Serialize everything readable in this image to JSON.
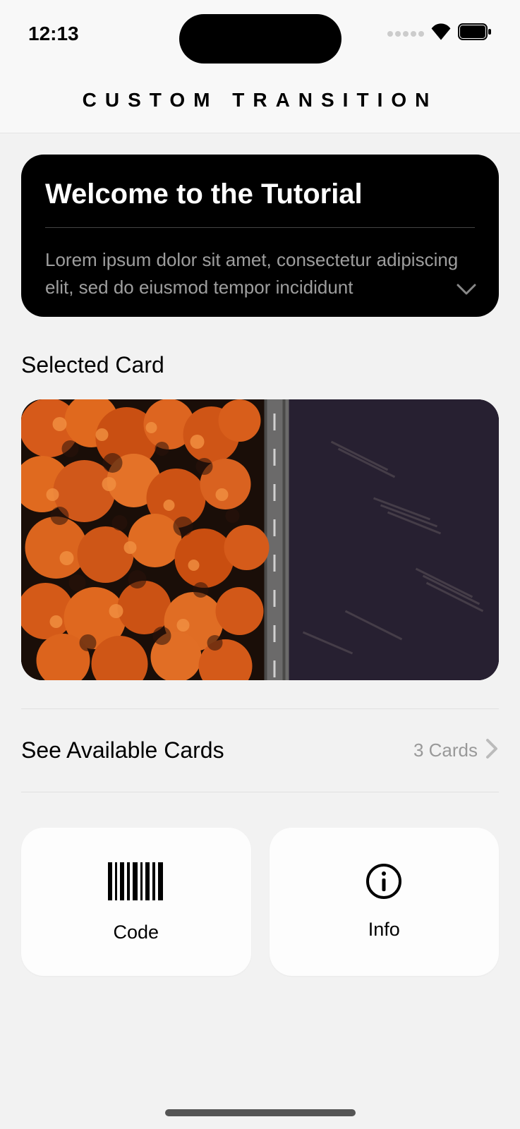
{
  "statusBar": {
    "time": "12:13"
  },
  "navBar": {
    "title": "CUSTOM TRANSITION"
  },
  "welcome": {
    "title": "Welcome to the Tutorial",
    "body": "Lorem ipsum dolor sit amet, consectetur adipiscing elit, sed do eiusmod tempor incididunt"
  },
  "sections": {
    "selectedCardLabel": "Selected Card",
    "seeCardsLabel": "See Available Cards",
    "cardCount": "3 Cards"
  },
  "tiles": {
    "code": "Code",
    "info": "Info"
  }
}
